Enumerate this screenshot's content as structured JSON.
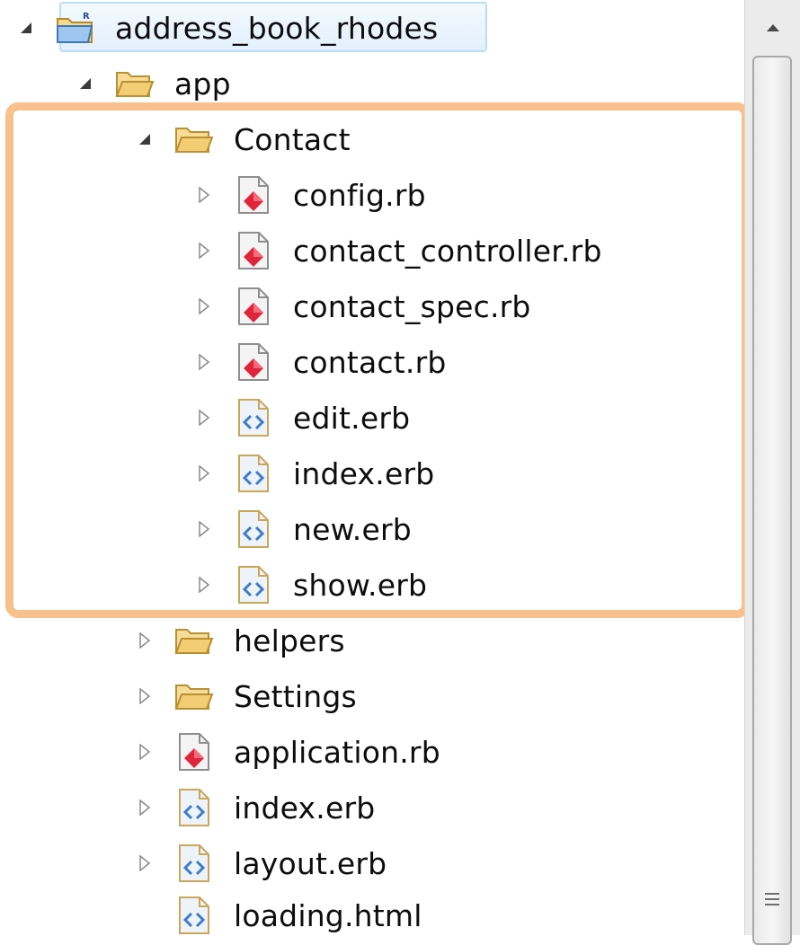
{
  "tree": {
    "root": {
      "label": "address_book_rhodes",
      "expanded": true
    },
    "app": {
      "label": "app",
      "expanded": true
    },
    "contact": {
      "label": "Contact",
      "expanded": true
    },
    "contact_files": [
      {
        "label": "config.rb",
        "type": "ruby"
      },
      {
        "label": "contact_controller.rb",
        "type": "ruby"
      },
      {
        "label": "contact_spec.rb",
        "type": "ruby"
      },
      {
        "label": "contact.rb",
        "type": "ruby"
      },
      {
        "label": "edit.erb",
        "type": "erb"
      },
      {
        "label": "index.erb",
        "type": "erb"
      },
      {
        "label": "new.erb",
        "type": "erb"
      },
      {
        "label": "show.erb",
        "type": "erb"
      }
    ],
    "app_children": [
      {
        "label": "helpers",
        "type": "folder",
        "twisty": true
      },
      {
        "label": "Settings",
        "type": "folder",
        "twisty": true
      },
      {
        "label": "application.rb",
        "type": "ruby",
        "twisty": true
      },
      {
        "label": "index.erb",
        "type": "erb",
        "twisty": true
      },
      {
        "label": "layout.erb",
        "type": "erb",
        "twisty": true
      },
      {
        "label": "loading.html",
        "type": "erb",
        "twisty": false
      }
    ]
  },
  "colors": {
    "highlight_border": "#f7c08d",
    "selection_fill": "#e3f0fc",
    "selection_border": "#bcdcf4",
    "ruby_icon": "#e0243a",
    "erb_icon": "#3e7cc9",
    "folder": "#f1c66b"
  },
  "icons": {
    "expanded": "expanded-triangle-icon",
    "collapsed": "collapsed-triangle-icon",
    "folder": "folder-open-icon",
    "project": "project-folder-icon",
    "ruby": "ruby-file-icon",
    "erb": "erb-file-icon"
  }
}
